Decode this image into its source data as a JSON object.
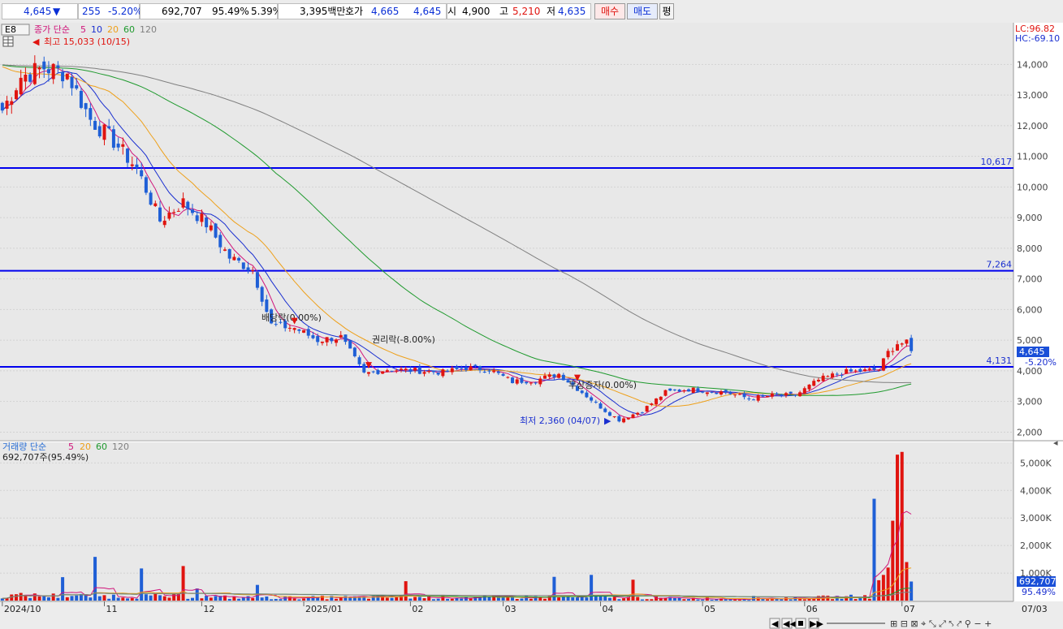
{
  "toolbar": {
    "price": "4,645",
    "arrow": "▼",
    "change": "255",
    "change_pct": "-5.20%",
    "volume": "692,707",
    "vol_ratio": "95.49%",
    "turnover": "5.39%",
    "amount": "3,395백만",
    "quote_label": "호가",
    "ask": "4,665",
    "bid": "4,645",
    "open_label": "시",
    "open": "4,900",
    "high_label": "고",
    "high": "5,210",
    "low_label": "저",
    "low": "4,635",
    "buy_label": "매수",
    "sell_label": "매도",
    "avg_label": "평"
  },
  "price_panel": {
    "code": "E8",
    "legend_prefix": "종가 단순",
    "ma_periods": [
      "5",
      "10",
      "20",
      "60",
      "120"
    ],
    "high_note": "최고 15,033 (10/15)",
    "low_note": "최저 2,360 (04/07)",
    "lc": "LC:96.82",
    "hc": "HC:-69.10",
    "current_price_tag": "4,645",
    "current_pct_tag": "-5.20%",
    "events": [
      {
        "label": "배당락(0.00%)",
        "date": "2024-12-30"
      },
      {
        "label": "권리락(-8.00%)",
        "date": "2025-01-21"
      },
      {
        "label": "무상증자(0.00%)",
        "date": "2025-03-25"
      }
    ]
  },
  "volume_panel": {
    "legend_prefix": "거래량  단순",
    "ma_periods": [
      "5",
      "20",
      "60",
      "120"
    ],
    "current": "692,707주(95.49%)",
    "current_tag": "692,707",
    "current_pct_tag": "95.49%"
  },
  "x_axis_labels": [
    "2024/10",
    "11",
    "12",
    "2025/01",
    "02",
    "03",
    "04",
    "05",
    "06",
    "07"
  ],
  "x_axis_right": "07/03",
  "colors": {
    "up": "#e0140f",
    "down": "#1f5fd6",
    "ma5": "#d0147a",
    "ma10": "#1a2fd0",
    "ma20": "#eea01a",
    "ma60": "#1f9a2e",
    "ma120": "#808080",
    "hline": "#0000ee",
    "background": "#e8e8e8"
  },
  "chart_data": {
    "type": "candlestick",
    "x_range": [
      "2024-10-02",
      "2025-07-03"
    ],
    "price_axis": {
      "ylim": [
        1800,
        15200
      ],
      "ticks": [
        2000,
        3000,
        4000,
        5000,
        6000,
        7000,
        8000,
        9000,
        10000,
        11000,
        12000,
        13000,
        14000
      ]
    },
    "price_axis_tick_labels": [
      "2,000",
      "3,000",
      "4,000",
      "5,000",
      "6,000",
      "7,000",
      "8,000",
      "9,000",
      "10,000",
      "11,000",
      "12,000",
      "13,000",
      "14,000"
    ],
    "volume_axis": {
      "ylim": [
        0,
        5600
      ],
      "ticks": [
        1000,
        2000,
        3000,
        4000,
        5000
      ],
      "unit": "K"
    },
    "volume_axis_tick_labels": [
      "1,000K",
      "2,000K",
      "3,000K",
      "4,000K",
      "5,000K"
    ],
    "horizontal_lines": [
      {
        "value": 10617,
        "label": "10,617"
      },
      {
        "value": 7264,
        "label": "7,264"
      },
      {
        "value": 4131,
        "label": "4,131"
      }
    ],
    "close_anchors": [
      {
        "x": "2024-10-02",
        "y": 12500
      },
      {
        "x": "2024-10-08",
        "y": 13600
      },
      {
        "x": "2024-10-15",
        "y": 13900
      },
      {
        "x": "2024-10-22",
        "y": 13700
      },
      {
        "x": "2024-10-29",
        "y": 12200
      },
      {
        "x": "2024-11-05",
        "y": 11500
      },
      {
        "x": "2024-11-12",
        "y": 10600
      },
      {
        "x": "2024-11-19",
        "y": 8900
      },
      {
        "x": "2024-11-26",
        "y": 9500
      },
      {
        "x": "2024-12-03",
        "y": 8800
      },
      {
        "x": "2024-12-10",
        "y": 7700
      },
      {
        "x": "2024-12-17",
        "y": 7300
      },
      {
        "x": "2024-12-23",
        "y": 5500
      },
      {
        "x": "2024-12-30",
        "y": 5400
      },
      {
        "x": "2025-01-06",
        "y": 5000
      },
      {
        "x": "2025-01-13",
        "y": 5100
      },
      {
        "x": "2025-01-20",
        "y": 3900
      },
      {
        "x": "2025-01-27",
        "y": 4050
      },
      {
        "x": "2025-02-05",
        "y": 4000
      },
      {
        "x": "2025-02-12",
        "y": 3950
      },
      {
        "x": "2025-02-19",
        "y": 4100
      },
      {
        "x": "2025-02-26",
        "y": 4050
      },
      {
        "x": "2025-03-05",
        "y": 3650
      },
      {
        "x": "2025-03-12",
        "y": 3700
      },
      {
        "x": "2025-03-19",
        "y": 3900
      },
      {
        "x": "2025-03-26",
        "y": 3300
      },
      {
        "x": "2025-04-02",
        "y": 2700
      },
      {
        "x": "2025-04-07",
        "y": 2400
      },
      {
        "x": "2025-04-14",
        "y": 2700
      },
      {
        "x": "2025-04-21",
        "y": 3300
      },
      {
        "x": "2025-04-28",
        "y": 3400
      },
      {
        "x": "2025-05-08",
        "y": 3300
      },
      {
        "x": "2025-05-15",
        "y": 3100
      },
      {
        "x": "2025-05-22",
        "y": 3200
      },
      {
        "x": "2025-05-29",
        "y": 3200
      },
      {
        "x": "2025-06-05",
        "y": 3700
      },
      {
        "x": "2025-06-12",
        "y": 3950
      },
      {
        "x": "2025-06-19",
        "y": 4000
      },
      {
        "x": "2025-06-24",
        "y": 4050
      },
      {
        "x": "2025-06-26",
        "y": 4600
      },
      {
        "x": "2025-06-30",
        "y": 4900
      },
      {
        "x": "2025-07-02",
        "y": 4900
      },
      {
        "x": "2025-07-03",
        "y": 4645
      }
    ],
    "volume_anchors": [
      {
        "x": "2024-10-10",
        "y": 180
      },
      {
        "x": "2024-11-25",
        "y": 150
      },
      {
        "x": "2024-12-20",
        "y": 100
      },
      {
        "x": "2025-01-20",
        "y": 120
      },
      {
        "x": "2025-03-25",
        "y": 120
      },
      {
        "x": "2025-05-15",
        "y": 60
      },
      {
        "x": "2025-06-20",
        "y": 150
      },
      {
        "x": "2025-06-26",
        "y": 1200
      },
      {
        "x": "2025-06-27",
        "y": 2900
      },
      {
        "x": "2025-06-30",
        "y": 5300
      },
      {
        "x": "2025-07-01",
        "y": 5400
      },
      {
        "x": "2025-07-02",
        "y": 1400
      },
      {
        "x": "2025-07-03",
        "y": 693
      }
    ]
  }
}
